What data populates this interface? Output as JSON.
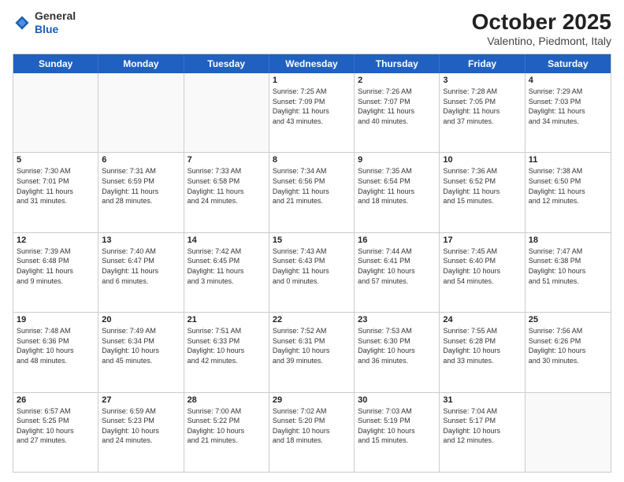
{
  "header": {
    "logo_general": "General",
    "logo_blue": "Blue",
    "month": "October 2025",
    "location": "Valentino, Piedmont, Italy"
  },
  "days_of_week": [
    "Sunday",
    "Monday",
    "Tuesday",
    "Wednesday",
    "Thursday",
    "Friday",
    "Saturday"
  ],
  "weeks": [
    [
      {
        "day": "",
        "empty": true
      },
      {
        "day": "",
        "empty": true
      },
      {
        "day": "",
        "empty": true
      },
      {
        "day": "1",
        "lines": [
          "Sunrise: 7:25 AM",
          "Sunset: 7:09 PM",
          "Daylight: 11 hours",
          "and 43 minutes."
        ]
      },
      {
        "day": "2",
        "lines": [
          "Sunrise: 7:26 AM",
          "Sunset: 7:07 PM",
          "Daylight: 11 hours",
          "and 40 minutes."
        ]
      },
      {
        "day": "3",
        "lines": [
          "Sunrise: 7:28 AM",
          "Sunset: 7:05 PM",
          "Daylight: 11 hours",
          "and 37 minutes."
        ]
      },
      {
        "day": "4",
        "lines": [
          "Sunrise: 7:29 AM",
          "Sunset: 7:03 PM",
          "Daylight: 11 hours",
          "and 34 minutes."
        ]
      }
    ],
    [
      {
        "day": "5",
        "lines": [
          "Sunrise: 7:30 AM",
          "Sunset: 7:01 PM",
          "Daylight: 11 hours",
          "and 31 minutes."
        ]
      },
      {
        "day": "6",
        "lines": [
          "Sunrise: 7:31 AM",
          "Sunset: 6:59 PM",
          "Daylight: 11 hours",
          "and 28 minutes."
        ]
      },
      {
        "day": "7",
        "lines": [
          "Sunrise: 7:33 AM",
          "Sunset: 6:58 PM",
          "Daylight: 11 hours",
          "and 24 minutes."
        ]
      },
      {
        "day": "8",
        "lines": [
          "Sunrise: 7:34 AM",
          "Sunset: 6:56 PM",
          "Daylight: 11 hours",
          "and 21 minutes."
        ]
      },
      {
        "day": "9",
        "lines": [
          "Sunrise: 7:35 AM",
          "Sunset: 6:54 PM",
          "Daylight: 11 hours",
          "and 18 minutes."
        ]
      },
      {
        "day": "10",
        "lines": [
          "Sunrise: 7:36 AM",
          "Sunset: 6:52 PM",
          "Daylight: 11 hours",
          "and 15 minutes."
        ]
      },
      {
        "day": "11",
        "lines": [
          "Sunrise: 7:38 AM",
          "Sunset: 6:50 PM",
          "Daylight: 11 hours",
          "and 12 minutes."
        ]
      }
    ],
    [
      {
        "day": "12",
        "lines": [
          "Sunrise: 7:39 AM",
          "Sunset: 6:48 PM",
          "Daylight: 11 hours",
          "and 9 minutes."
        ]
      },
      {
        "day": "13",
        "lines": [
          "Sunrise: 7:40 AM",
          "Sunset: 6:47 PM",
          "Daylight: 11 hours",
          "and 6 minutes."
        ]
      },
      {
        "day": "14",
        "lines": [
          "Sunrise: 7:42 AM",
          "Sunset: 6:45 PM",
          "Daylight: 11 hours",
          "and 3 minutes."
        ]
      },
      {
        "day": "15",
        "lines": [
          "Sunrise: 7:43 AM",
          "Sunset: 6:43 PM",
          "Daylight: 11 hours",
          "and 0 minutes."
        ]
      },
      {
        "day": "16",
        "lines": [
          "Sunrise: 7:44 AM",
          "Sunset: 6:41 PM",
          "Daylight: 10 hours",
          "and 57 minutes."
        ]
      },
      {
        "day": "17",
        "lines": [
          "Sunrise: 7:45 AM",
          "Sunset: 6:40 PM",
          "Daylight: 10 hours",
          "and 54 minutes."
        ]
      },
      {
        "day": "18",
        "lines": [
          "Sunrise: 7:47 AM",
          "Sunset: 6:38 PM",
          "Daylight: 10 hours",
          "and 51 minutes."
        ]
      }
    ],
    [
      {
        "day": "19",
        "lines": [
          "Sunrise: 7:48 AM",
          "Sunset: 6:36 PM",
          "Daylight: 10 hours",
          "and 48 minutes."
        ]
      },
      {
        "day": "20",
        "lines": [
          "Sunrise: 7:49 AM",
          "Sunset: 6:34 PM",
          "Daylight: 10 hours",
          "and 45 minutes."
        ]
      },
      {
        "day": "21",
        "lines": [
          "Sunrise: 7:51 AM",
          "Sunset: 6:33 PM",
          "Daylight: 10 hours",
          "and 42 minutes."
        ]
      },
      {
        "day": "22",
        "lines": [
          "Sunrise: 7:52 AM",
          "Sunset: 6:31 PM",
          "Daylight: 10 hours",
          "and 39 minutes."
        ]
      },
      {
        "day": "23",
        "lines": [
          "Sunrise: 7:53 AM",
          "Sunset: 6:30 PM",
          "Daylight: 10 hours",
          "and 36 minutes."
        ]
      },
      {
        "day": "24",
        "lines": [
          "Sunrise: 7:55 AM",
          "Sunset: 6:28 PM",
          "Daylight: 10 hours",
          "and 33 minutes."
        ]
      },
      {
        "day": "25",
        "lines": [
          "Sunrise: 7:56 AM",
          "Sunset: 6:26 PM",
          "Daylight: 10 hours",
          "and 30 minutes."
        ]
      }
    ],
    [
      {
        "day": "26",
        "lines": [
          "Sunrise: 6:57 AM",
          "Sunset: 5:25 PM",
          "Daylight: 10 hours",
          "and 27 minutes."
        ]
      },
      {
        "day": "27",
        "lines": [
          "Sunrise: 6:59 AM",
          "Sunset: 5:23 PM",
          "Daylight: 10 hours",
          "and 24 minutes."
        ]
      },
      {
        "day": "28",
        "lines": [
          "Sunrise: 7:00 AM",
          "Sunset: 5:22 PM",
          "Daylight: 10 hours",
          "and 21 minutes."
        ]
      },
      {
        "day": "29",
        "lines": [
          "Sunrise: 7:02 AM",
          "Sunset: 5:20 PM",
          "Daylight: 10 hours",
          "and 18 minutes."
        ]
      },
      {
        "day": "30",
        "lines": [
          "Sunrise: 7:03 AM",
          "Sunset: 5:19 PM",
          "Daylight: 10 hours",
          "and 15 minutes."
        ]
      },
      {
        "day": "31",
        "lines": [
          "Sunrise: 7:04 AM",
          "Sunset: 5:17 PM",
          "Daylight: 10 hours",
          "and 12 minutes."
        ]
      },
      {
        "day": "",
        "empty": true
      }
    ]
  ]
}
